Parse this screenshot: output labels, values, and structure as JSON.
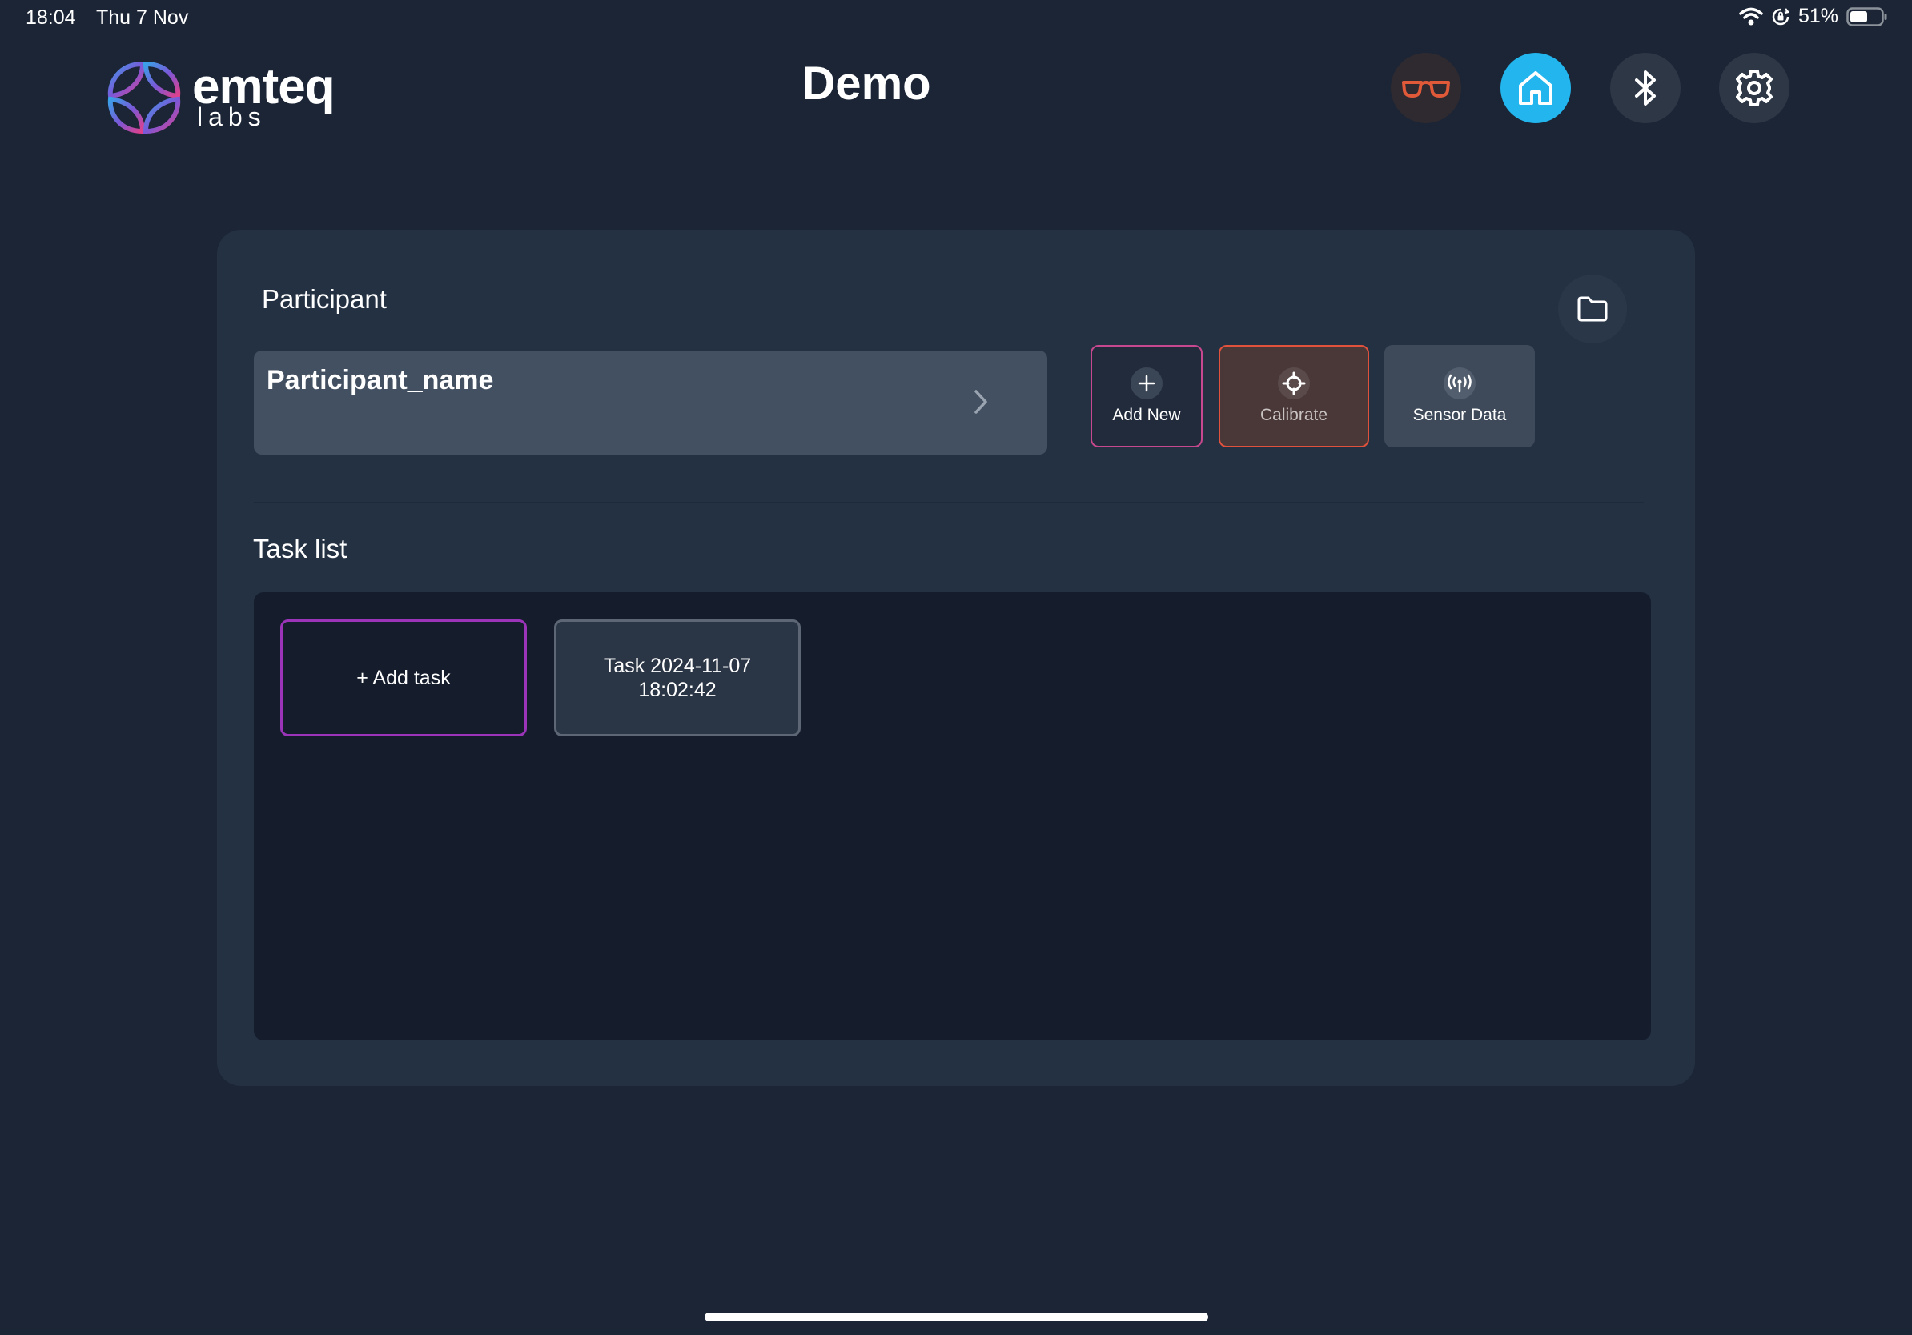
{
  "status_bar": {
    "time": "18:04",
    "date": "Thu 7 Nov",
    "battery": "51%",
    "icons": [
      "wifi-icon",
      "orientation-lock-icon",
      "battery-icon"
    ]
  },
  "header": {
    "logo_text": "emteq",
    "logo_subtext": "labs",
    "title": "Demo",
    "buttons": [
      {
        "icon": "glasses-icon",
        "color": "#e05a3a"
      },
      {
        "icon": "home-icon",
        "color": "#22b5ee"
      },
      {
        "icon": "bluetooth-icon",
        "color": "#ffffff"
      },
      {
        "icon": "gear-icon",
        "color": "#ffffff"
      }
    ]
  },
  "participant": {
    "label": "Participant",
    "selected_name": "Participant_name",
    "actions": {
      "add_new": "Add New",
      "calibrate": "Calibrate",
      "sensor_data": "Sensor Data"
    }
  },
  "tasks": {
    "label": "Task list",
    "add_task": "+ Add task",
    "items": [
      {
        "name": "Task 2024-11-07 18:02:42"
      }
    ]
  },
  "colors": {
    "background": "#1b2536",
    "card": "#243143",
    "accent_home": "#22b5ee",
    "add_new_border": "#c8488f",
    "calibrate_border": "#e0523c",
    "add_task_border": "#9b34b8"
  }
}
